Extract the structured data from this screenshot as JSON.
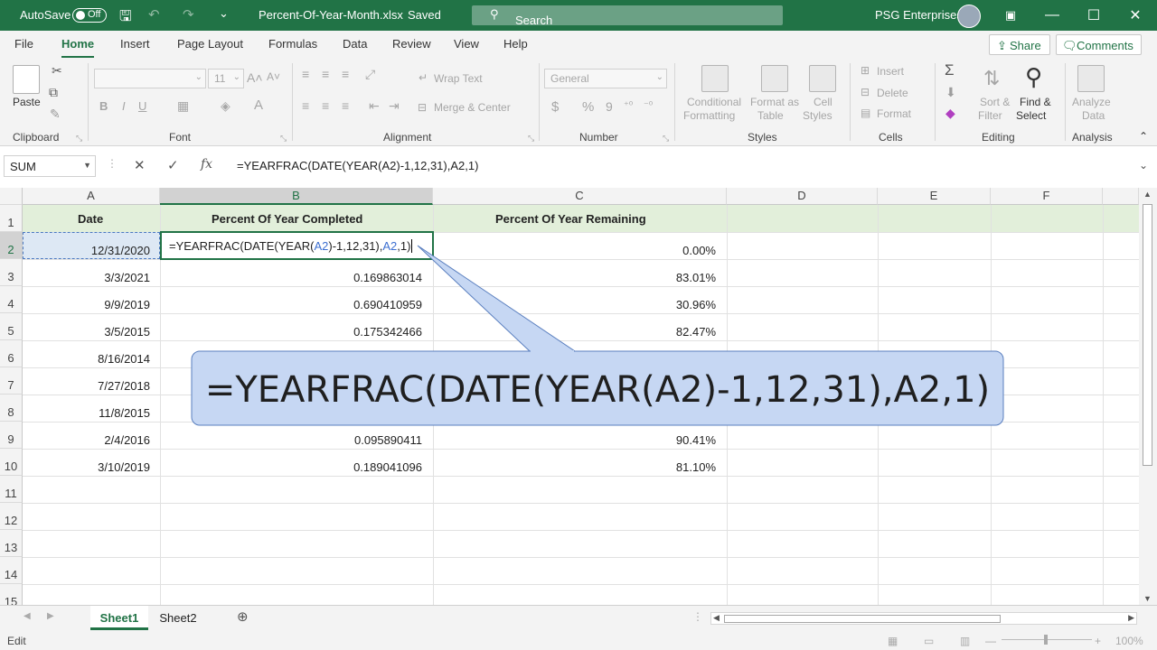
{
  "titlebar": {
    "autosave_label": "AutoSave",
    "autosave_state": "Off",
    "filename": "Percent-Of-Year-Month.xlsx",
    "save_status": "Saved",
    "search_placeholder": "Search",
    "user_name": "PSG Enterprises"
  },
  "tabs": [
    "File",
    "Home",
    "Insert",
    "Page Layout",
    "Formulas",
    "Data",
    "Review",
    "View",
    "Help"
  ],
  "active_tab": "Home",
  "share_label": "Share",
  "comments_label": "Comments",
  "ribbon": {
    "clipboard": {
      "label": "Clipboard",
      "paste": "Paste"
    },
    "font": {
      "label": "Font",
      "size": "11",
      "bold": "B",
      "italic": "I",
      "underline": "U"
    },
    "alignment": {
      "label": "Alignment",
      "wrap": "Wrap Text",
      "merge": "Merge & Center"
    },
    "number": {
      "label": "Number",
      "format": "General",
      "currency": "$",
      "percent": "%",
      "comma": "9"
    },
    "styles": {
      "label": "Styles",
      "conditional": [
        "Conditional",
        "Formatting"
      ],
      "format_table": [
        "Format as",
        "Table"
      ],
      "cell_styles": [
        "Cell",
        "Styles"
      ]
    },
    "cells": {
      "label": "Cells",
      "insert": "Insert",
      "delete": "Delete",
      "format": "Format"
    },
    "editing": {
      "label": "Editing",
      "sort": [
        "Sort &",
        "Filter"
      ],
      "find": [
        "Find &",
        "Select"
      ]
    },
    "analysis": {
      "label": "Analysis",
      "analyze": [
        "Analyze",
        "Data"
      ]
    }
  },
  "formula_bar": {
    "name_box": "SUM",
    "formula": "=YEARFRAC(DATE(YEAR(A2)-1,12,31),A2,1)"
  },
  "columns": [
    "A",
    "B",
    "C",
    "D",
    "E",
    "F"
  ],
  "rows": [
    "1",
    "2",
    "3",
    "4",
    "5",
    "6",
    "7",
    "8",
    "9",
    "10",
    "11",
    "12",
    "13",
    "14",
    "15"
  ],
  "headers": {
    "a": "Date",
    "b": "Percent Of Year Completed",
    "c": "Percent Of Year Remaining"
  },
  "edit_cell": {
    "p1": "=YEARFRAC(DATE(YEAR(",
    "ref1": "A2",
    "p2": ")-1,12,31),",
    "ref2": "A2",
    "p3": ",1)"
  },
  "data_rows": [
    {
      "date": "12/31/2020",
      "completed": "",
      "remaining": "0.00%"
    },
    {
      "date": "3/3/2021",
      "completed": "0.169863014",
      "remaining": "83.01%"
    },
    {
      "date": "9/9/2019",
      "completed": "0.690410959",
      "remaining": "30.96%"
    },
    {
      "date": "3/5/2015",
      "completed": "0.175342466",
      "remaining": "82.47%"
    },
    {
      "date": "8/16/2014",
      "completed": "",
      "remaining": ""
    },
    {
      "date": "7/27/2018",
      "completed": "",
      "remaining": ""
    },
    {
      "date": "11/8/2015",
      "completed": "",
      "remaining": ""
    },
    {
      "date": "2/4/2016",
      "completed": "0.095890411",
      "remaining": "90.41%"
    },
    {
      "date": "3/10/2019",
      "completed": "0.189041096",
      "remaining": "81.10%"
    }
  ],
  "callout_text": "=YEARFRAC(DATE(YEAR(A2)-1,12,31),A2,1)",
  "sheets": [
    "Sheet1",
    "Sheet2"
  ],
  "active_sheet": "Sheet1",
  "status_mode": "Edit",
  "zoom": "100%"
}
